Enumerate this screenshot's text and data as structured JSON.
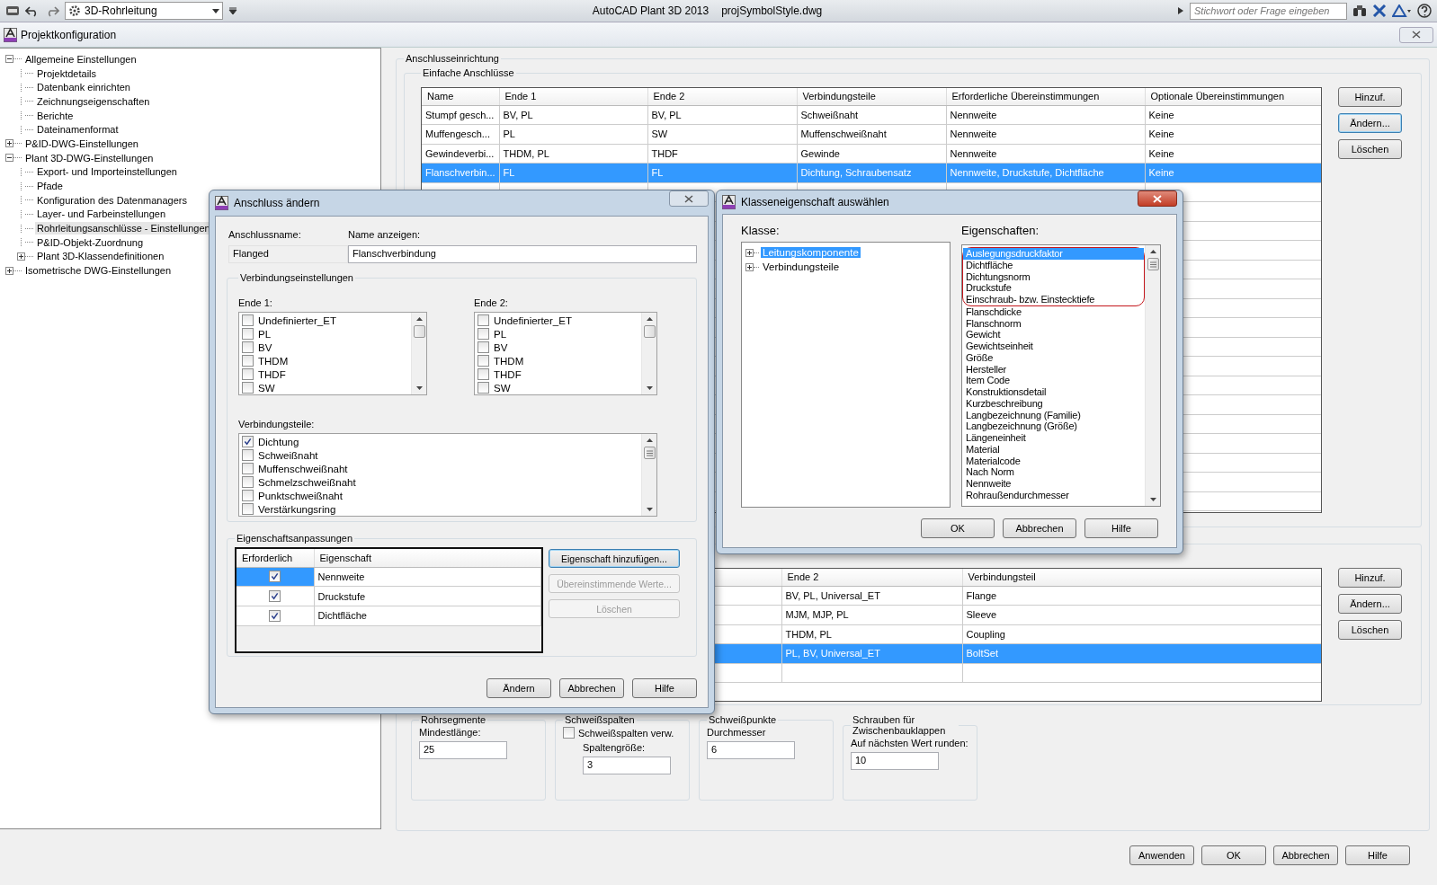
{
  "toolbar": {
    "workspace": "3D-Rohrleitung",
    "app_title": "AutoCAD Plant 3D 2013",
    "file_name": "projSymbolStyle.dwg",
    "search_placeholder": "Stichwort oder Frage eingeben"
  },
  "window": {
    "title": "Projektkonfiguration"
  },
  "tree": [
    {
      "label": "Allgemeine Einstellungen",
      "selected": false,
      "expanded": true,
      "children": [
        {
          "label": "Projektdetails",
          "selected": false
        },
        {
          "label": "Datenbank einrichten",
          "selected": false
        },
        {
          "label": "Zeichnungseigenschaften",
          "selected": false
        },
        {
          "label": "Berichte",
          "selected": false
        },
        {
          "label": "Dateinamenformat",
          "selected": false
        }
      ]
    },
    {
      "label": "P&ID-DWG-Einstellungen",
      "selected": false,
      "expanded": false
    },
    {
      "label": "Plant 3D-DWG-Einstellungen",
      "selected": false,
      "expanded": true,
      "children": [
        {
          "label": "Export- und Importeinstellungen",
          "selected": false
        },
        {
          "label": "Pfade",
          "selected": false
        },
        {
          "label": "Konfiguration des Datenmanagers",
          "selected": false
        },
        {
          "label": "Layer- und Farbeinstellungen",
          "selected": false
        },
        {
          "label": "Rohrleitungsanschlüsse - Einstellungen",
          "selected": true
        },
        {
          "label": "P&ID-Objekt-Zuordnung",
          "selected": false
        },
        {
          "label": "Plant 3D-Klassendefinitionen",
          "selected": false,
          "expanded": false
        }
      ]
    },
    {
      "label": "Isometrische DWG-Einstellungen",
      "selected": false,
      "expanded": false
    }
  ],
  "connections": {
    "title": "Anschlusseinrichtung",
    "simple": {
      "title": "Einfache Anschlüsse",
      "columns": [
        "Name",
        "Ende 1",
        "Ende 2",
        "Verbindungsteile",
        "Erforderliche Übereinstimmungen",
        "Optionale Übereinstimmungen"
      ],
      "rows": [
        {
          "cells": [
            "Stumpf gesch...",
            "BV, PL",
            "BV, PL",
            "Schweißnaht",
            "Nennweite",
            "Keine"
          ],
          "selected": false
        },
        {
          "cells": [
            "Muffengesch...",
            "PL",
            "SW",
            "Muffenschweißnaht",
            "Nennweite",
            "Keine"
          ],
          "selected": false
        },
        {
          "cells": [
            "Gewindeverbi...",
            "THDM, PL",
            "THDF",
            "Gewinde",
            "Nennweite",
            "Keine"
          ],
          "selected": false
        },
        {
          "cells": [
            "Flanschverbin...",
            "FL",
            "FL",
            "Dichtung, Schraubensatz",
            "Nennweite, Druckstufe, Dichtfläche",
            "Keine"
          ],
          "selected": true
        }
      ],
      "buttons": [
        {
          "label": "Hinzuf.",
          "focused": false
        },
        {
          "label": "Ändern...",
          "focused": true
        },
        {
          "label": "Löschen",
          "focused": false
        }
      ]
    },
    "fittings": {
      "columns": [
        "Ende 2",
        "Verbindungsteil"
      ],
      "rows": [
        {
          "cells": [
            "BV, PL, Universal_ET",
            "Flange"
          ],
          "selected": false
        },
        {
          "cells": [
            "MJM, MJP, PL",
            "Sleeve"
          ],
          "selected": false
        },
        {
          "cells": [
            "THDM, PL",
            "Coupling"
          ],
          "selected": false
        },
        {
          "cells": [
            "PL, BV, Universal_ET",
            "BoltSet"
          ],
          "selected": true
        }
      ],
      "buttons": [
        {
          "label": "Hinzuf.",
          "focused": false
        },
        {
          "label": "Ändern...",
          "focused": false
        },
        {
          "label": "Löschen",
          "focused": false
        }
      ]
    },
    "groups": [
      {
        "title": "Rohrsegmente",
        "items": [
          {
            "kind": "field",
            "label": "Mindestlänge:",
            "value": "25"
          }
        ]
      },
      {
        "title": "Schweißspalten",
        "items": [
          {
            "kind": "checkbox",
            "label": "Schweißspalten verw.",
            "checked": false
          },
          {
            "kind": "field",
            "label": "Spaltengröße:",
            "value": "3"
          }
        ]
      },
      {
        "title": "Schweißpunkte",
        "items": [
          {
            "kind": "field",
            "label": "Durchmesser",
            "value": "6"
          }
        ]
      },
      {
        "title": "Schrauben für Zwischenbauklappen",
        "items": [
          {
            "kind": "field",
            "label": "Auf nächsten Wert runden:",
            "value": "10"
          }
        ]
      }
    ]
  },
  "footer_buttons": [
    "Anwenden",
    "OK",
    "Abbrechen",
    "Hilfe"
  ],
  "edit_dialog": {
    "title": "Anschluss ändern",
    "name_label": "Anschlussname:",
    "name_value": "Flanged",
    "display_label": "Name anzeigen:",
    "display_value": "Flanschverbindung",
    "settings_title": "Verbindungseinstellungen",
    "end1": {
      "label": "Ende 1:",
      "items": [
        {
          "label": "Undefinierter_ET",
          "checked": false
        },
        {
          "label": "PL",
          "checked": false
        },
        {
          "label": "BV",
          "checked": false
        },
        {
          "label": "THDM",
          "checked": false
        },
        {
          "label": "THDF",
          "checked": false
        },
        {
          "label": "SW",
          "checked": false
        }
      ]
    },
    "end2": {
      "label": "Ende 2:",
      "items": [
        {
          "label": "Undefinierter_ET",
          "checked": false
        },
        {
          "label": "PL",
          "checked": false
        },
        {
          "label": "BV",
          "checked": false
        },
        {
          "label": "THDM",
          "checked": false
        },
        {
          "label": "THDF",
          "checked": false
        },
        {
          "label": "SW",
          "checked": false
        }
      ]
    },
    "parts": {
      "label": "Verbindungsteile:",
      "items": [
        {
          "label": "Dichtung",
          "checked": true
        },
        {
          "label": "Schweißnaht",
          "checked": false
        },
        {
          "label": "Muffenschweißnaht",
          "checked": false
        },
        {
          "label": "Schmelzschweißnaht",
          "checked": false
        },
        {
          "label": "Punktschweißnaht",
          "checked": false
        },
        {
          "label": "Verstärkungsring",
          "checked": false
        }
      ]
    },
    "props_title": "Eigenschaftsanpassungen",
    "props_columns": [
      "Erforderlich",
      "Eigenschaft"
    ],
    "props_rows": [
      {
        "required": true,
        "property": "Nennweite",
        "selected": true
      },
      {
        "required": true,
        "property": "Druckstufe",
        "selected": false
      },
      {
        "required": true,
        "property": "Dichtfläche",
        "selected": false
      }
    ],
    "props_buttons": [
      {
        "label": "Eigenschaft hinzufügen...",
        "disabled": false,
        "focused": true
      },
      {
        "label": "Übereinstimmende Werte...",
        "disabled": true,
        "focused": false
      },
      {
        "label": "Löschen",
        "disabled": true,
        "focused": false
      }
    ],
    "buttons": [
      "Ändern",
      "Abbrechen",
      "Hilfe"
    ]
  },
  "class_dialog": {
    "title": "Klasseneigenschaft auswählen",
    "class_label": "Klasse:",
    "classes": [
      {
        "label": "Leitungskomponente",
        "selected": true,
        "expanded": false
      },
      {
        "label": "Verbindungsteile",
        "selected": false,
        "expanded": false
      }
    ],
    "properties_label": "Eigenschaften:",
    "properties": [
      {
        "label": "Auslegungsdruckfaktor",
        "selected": true,
        "highlighted": true
      },
      {
        "label": "Dichtfläche",
        "selected": false,
        "highlighted": true
      },
      {
        "label": "Dichtungsnorm",
        "selected": false,
        "highlighted": true
      },
      {
        "label": "Druckstufe",
        "selected": false,
        "highlighted": true
      },
      {
        "label": "Einschraub- bzw. Einstecktiefe",
        "selected": false,
        "highlighted": true
      },
      {
        "label": "Flanschdicke",
        "selected": false,
        "highlighted": false
      },
      {
        "label": "Flanschnorm",
        "selected": false,
        "highlighted": false
      },
      {
        "label": "Gewicht",
        "selected": false,
        "highlighted": false
      },
      {
        "label": "Gewichtseinheit",
        "selected": false,
        "highlighted": false
      },
      {
        "label": "Größe",
        "selected": false,
        "highlighted": false
      },
      {
        "label": "Hersteller",
        "selected": false,
        "highlighted": false
      },
      {
        "label": "Item Code",
        "selected": false,
        "highlighted": false
      },
      {
        "label": "Konstruktionsdetail",
        "selected": false,
        "highlighted": false
      },
      {
        "label": "Kurzbeschreibung",
        "selected": false,
        "highlighted": false
      },
      {
        "label": "Langbezeichnung (Familie)",
        "selected": false,
        "highlighted": false
      },
      {
        "label": "Langbezeichnung (Größe)",
        "selected": false,
        "highlighted": false
      },
      {
        "label": "Längeneinheit",
        "selected": false,
        "highlighted": false
      },
      {
        "label": "Material",
        "selected": false,
        "highlighted": false
      },
      {
        "label": "Materialcode",
        "selected": false,
        "highlighted": false
      },
      {
        "label": "Nach Norm",
        "selected": false,
        "highlighted": false
      },
      {
        "label": "Nennweite",
        "selected": false,
        "highlighted": false
      },
      {
        "label": "Rohraußendurchmesser",
        "selected": false,
        "highlighted": false
      }
    ],
    "buttons": [
      "OK",
      "Abbrechen",
      "Hilfe"
    ]
  }
}
